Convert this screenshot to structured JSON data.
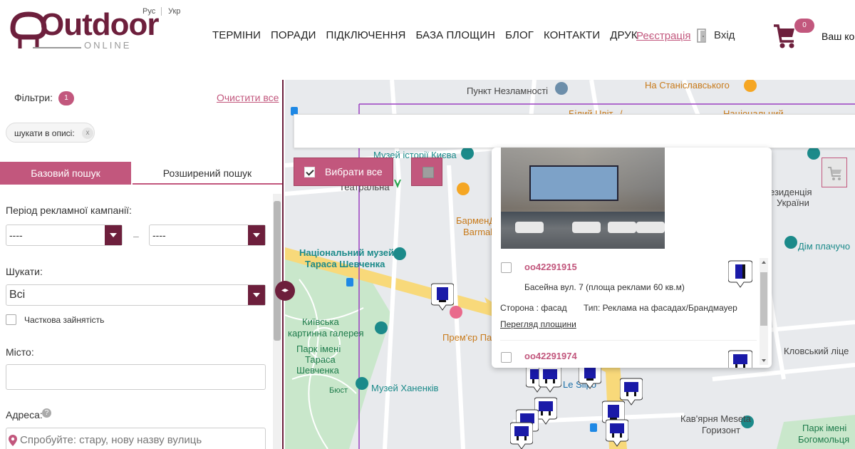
{
  "header": {
    "logo_text": "Outdoor",
    "logo_sub": "ONLINE",
    "lang_ru": "Рус",
    "lang_uk": "Укр",
    "nav": [
      "ТЕРМІНИ",
      "ПОРАДИ",
      "ПІДКЛЮЧЕННЯ",
      "БАЗА ПЛОЩИН",
      "БЛОГ",
      "КОНТАКТИ",
      "ДРУК"
    ],
    "register": "Реєстрація",
    "login": "Вхід",
    "cart_count": "0",
    "cart_label": "Ваш ко"
  },
  "sidebar": {
    "filters_label": "Фільтри:",
    "filters_count": "1",
    "clear_all": "Очистити все",
    "chip_text": "шукати в описі:",
    "chip_close": "x",
    "tab_basic": "Базовий пошук",
    "tab_advanced": "Розширений пошук",
    "period_label": "Період рекламної кампанії:",
    "period_from": "----",
    "period_to": "----",
    "period_sep": "–",
    "search_label": "Шукати:",
    "search_value": "Всі",
    "partial_label": "Часткова зайнятість",
    "city_label": "Місто:",
    "address_label": "Адреса:",
    "address_help": "?",
    "address_placeholder": "Спробуйте: стару, нову назву вулиць",
    "collapse_icon": "◂▸"
  },
  "map": {
    "labels": [
      {
        "id": "punkt",
        "text": "Пункт Незламності",
        "color": "dark"
      },
      {
        "id": "stanislav",
        "text": "На Станіславського",
        "color": "orange"
      },
      {
        "id": "museum_kyiv",
        "text": "Музей історії Києва",
        "color": "teal"
      },
      {
        "id": "teatralna",
        "text": "Театральна",
        "color": "dark"
      },
      {
        "id": "rezydentsia",
        "text": "езиденція",
        "color": "dark"
      },
      {
        "id": "ukraine",
        "text": "України",
        "color": "dark"
      },
      {
        "id": "barmen",
        "text": "БарменД",
        "color": "orange"
      },
      {
        "id": "barma",
        "text": "Barmal",
        "color": "orange"
      },
      {
        "id": "natsmuseum1",
        "text": "Національний музей",
        "color": "teal"
      },
      {
        "id": "natsmuseum2",
        "text": "Тараса Шевченка",
        "color": "teal"
      },
      {
        "id": "dim",
        "text": "Дім плачучо",
        "color": "teal"
      },
      {
        "id": "kyivska1",
        "text": "Київська",
        "color": "green"
      },
      {
        "id": "kyivska2",
        "text": "картинна галерея",
        "color": "green"
      },
      {
        "id": "premier",
        "text": "Прем'єр Па",
        "color": "orange"
      },
      {
        "id": "park1",
        "text": "Парк імені",
        "color": "green"
      },
      {
        "id": "park2",
        "text": "Тараса",
        "color": "green"
      },
      {
        "id": "park3",
        "text": "Шевченка",
        "color": "green"
      },
      {
        "id": "bust",
        "text": "Бюст",
        "color": "green"
      },
      {
        "id": "khanenko",
        "text": "Музей Ханенків",
        "color": "teal"
      },
      {
        "id": "klovsky",
        "text": "Кловський ліце",
        "color": "dark"
      },
      {
        "id": "lesilpo",
        "text": "Le Silpo",
        "color": "blue"
      },
      {
        "id": "meseta1",
        "text": "Кав'ярня Meseta",
        "color": "dark"
      },
      {
        "id": "meseta2",
        "text": "Горизонт",
        "color": "dark"
      },
      {
        "id": "park_bog1",
        "text": "Парк імені",
        "color": "green"
      },
      {
        "id": "park_bog2",
        "text": "Богомольця",
        "color": "green"
      },
      {
        "id": "biliy",
        "text": "Білий Цвіт.../",
        "color": "orange"
      },
      {
        "id": "natsionalny",
        "text": "Національний",
        "color": "orange"
      }
    ],
    "select_all": "Вибрати все",
    "popup": {
      "item1_id": "оо42291915",
      "item1_address": "Басейна вул. 7 (площа реклами 60 кв.м)",
      "item1_side": "Сторона : фасад",
      "item1_type": "Тип: Реклама на фасадах/Брандмауер",
      "item1_view": "Перегляд площини",
      "item2_id": "оо42291974"
    }
  },
  "colors": {
    "brand": "#6d1f3c",
    "accent": "#c2577d",
    "map_bg": "#e8eaed",
    "park": "#c9e7cb",
    "road_yellow": "#f8d97a"
  }
}
